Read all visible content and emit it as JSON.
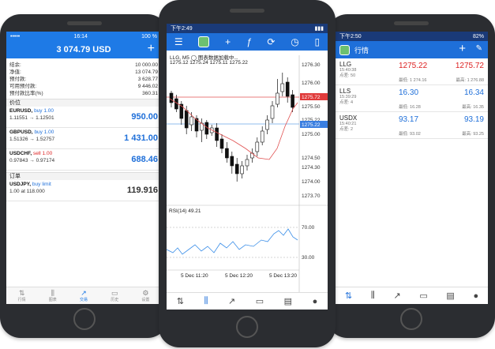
{
  "left": {
    "status": {
      "time": "16:14",
      "battery": "100 %"
    },
    "balance": "3 074.79 USD",
    "plus": "+",
    "account_rows": [
      {
        "label": "结余:",
        "value": "10 000.00"
      },
      {
        "label": "净值:",
        "value": "13 074.79"
      },
      {
        "label": "预付款:",
        "value": "3 628.77"
      },
      {
        "label": "可用预付款:",
        "value": "9 446.02"
      },
      {
        "label": "预付款比率(%)",
        "value": "360.31"
      }
    ],
    "positions_header": "价位",
    "positions": [
      {
        "symbol": "EURUSD,",
        "action": "buy 1.00",
        "type": "buy",
        "prices": "1.11551 → 1.12501",
        "profit": "950.00"
      },
      {
        "symbol": "GBPUSD,",
        "action": "buy 1.00",
        "type": "buy",
        "prices": "1.51326 → 1.52757",
        "profit": "1 431.00"
      },
      {
        "symbol": "USDCHF,",
        "action": "sell 1.00",
        "type": "sell",
        "prices": "0.97843 → 0.97174",
        "profit": "688.46"
      }
    ],
    "orders_header": "订单",
    "orders": [
      {
        "symbol": "USDJPY,",
        "action": "buy limit",
        "type": "buy",
        "prices": "1.00 at 118.000",
        "profit": "119.916"
      }
    ],
    "tabs": [
      "行情",
      "图表",
      "交易",
      "历史",
      "设置"
    ]
  },
  "middle": {
    "status": {
      "time": "下午2:49"
    },
    "chart_header": "LLG, M5  ◯ 图表数据加载中...",
    "ohlc": "1275.12 1275.24 1275.11 1275.22",
    "price_labels": [
      "1276.30",
      "1276.00",
      "1275.50",
      "1275.22",
      "1275.00",
      "1274.50",
      "1274.30",
      "1274.00",
      "1273.70"
    ],
    "red_line_label": "1275.72",
    "blue_line_label": "1275.22",
    "rsi_label": "RSI(14) 49.21",
    "rsi_levels": [
      "70.00",
      "30.00"
    ],
    "time_labels": [
      "5 Dec 11:20",
      "5 Dec 12:20",
      "5 Dec 13:20"
    ]
  },
  "right": {
    "status": {
      "time": "下午2:50",
      "battery": "82%"
    },
    "title": "行情",
    "quotes": [
      {
        "symbol": "LLG",
        "time": "15:40:38",
        "spread": "点差: 50",
        "bid": "1275.22",
        "ask": "1275.72",
        "bid_color": "#dd2222",
        "ask_color": "#dd2222",
        "low": "最低: 1 274.16",
        "high": "最高: 1 276.88"
      },
      {
        "symbol": "LLS",
        "time": "15:39:29",
        "spread": "点差: 4",
        "bid": "16.30",
        "ask": "16.34",
        "bid_color": "#1e6fd9",
        "ask_color": "#1e6fd9",
        "low": "最低: 16.28",
        "high": "最高: 16.35"
      },
      {
        "symbol": "USDX",
        "time": "15:40:21",
        "spread": "点差: 2",
        "bid": "93.17",
        "ask": "93.19",
        "bid_color": "#1e6fd9",
        "ask_color": "#1e6fd9",
        "low": "最低: 93.02",
        "high": "最高: 93.25"
      }
    ]
  }
}
